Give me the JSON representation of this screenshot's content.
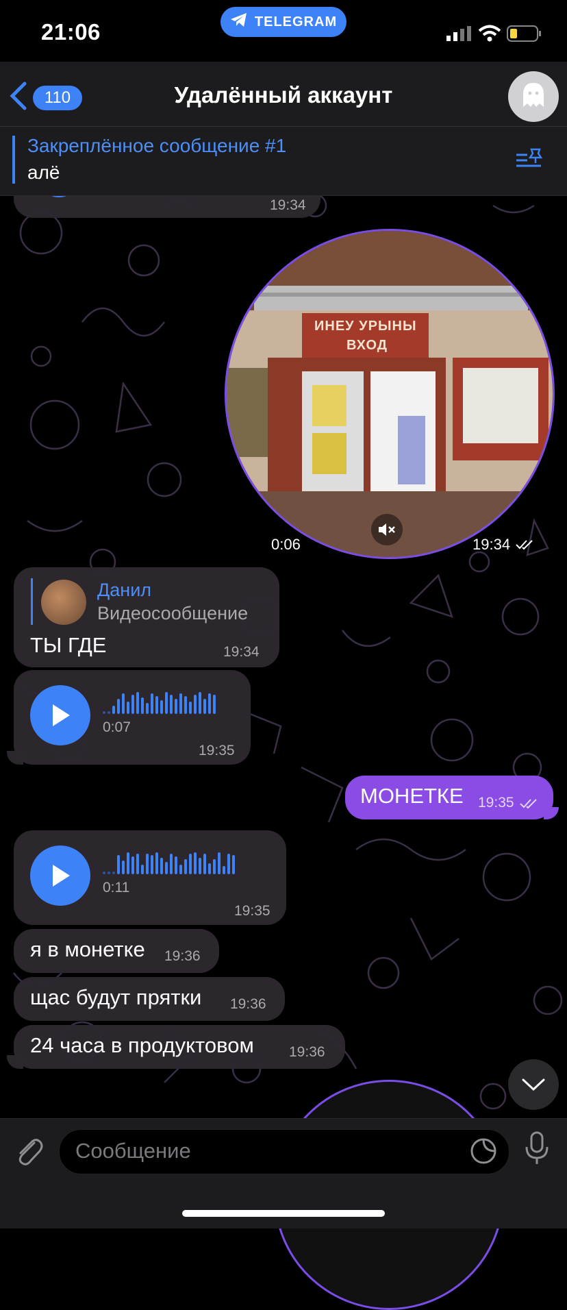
{
  "status_bar": {
    "time": "21:06",
    "app_pill": "TELEGRAM"
  },
  "nav": {
    "back_count": "110",
    "title": "Удалённый аккаунт"
  },
  "pinned": {
    "title": "Закреплённое сообщение #1",
    "text": "алё"
  },
  "messages": {
    "top_partial_time": "19:34",
    "video": {
      "duration": "0:06",
      "time": "19:34",
      "sign_line1": "ИНЕУ УРЫНЫ",
      "sign_line2": "ВХОД"
    },
    "reply": {
      "author": "Данил",
      "quoted": "Видеосообщение",
      "text": "ТЫ ГДЕ",
      "time": "19:34"
    },
    "voice1": {
      "duration": "0:07",
      "time": "19:35"
    },
    "out1": {
      "text": "МОНЕТКЕ",
      "time": "19:35"
    },
    "voice2": {
      "duration": "0:11",
      "time": "19:35"
    },
    "m1": {
      "text": "я в монетке",
      "time": "19:36"
    },
    "m2": {
      "text": "щас будут прятки",
      "time": "19:36"
    },
    "m3": {
      "text": "24 часа в продуктовом",
      "time": "19:36"
    }
  },
  "composer": {
    "placeholder": "Сообщение"
  },
  "colors": {
    "accent": "#3e82f7",
    "outgoing": "#8b4ce6",
    "bubble": "#2c282e"
  },
  "icons": [
    "telegram-icon",
    "back-chevron-icon",
    "ghost-avatar-icon",
    "pinned-list-icon",
    "play-icon",
    "mute-icon",
    "read-check-icon",
    "attach-icon",
    "sticker-icon",
    "microphone-icon",
    "chevron-down-icon"
  ]
}
